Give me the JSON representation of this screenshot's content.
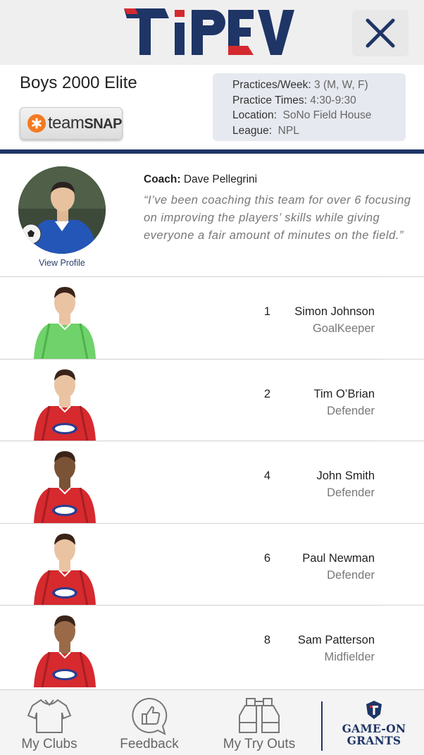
{
  "header": {
    "logo_text": "TiPEVO",
    "brand_colors": {
      "navy": "#1e3566",
      "red": "#d42a2f"
    }
  },
  "team": {
    "name": "Boys 2000 Elite",
    "teamsnap_label_part1": "team",
    "teamsnap_label_part2": "SNAP",
    "practice": {
      "per_week_label": "Practices/Week:",
      "per_week_value": "3 (M, W, F)",
      "times_label": "Practice Times:",
      "times_value": "4:30-9:30",
      "location_label": "Location:",
      "location_value": "SoNo Field House",
      "league_label": "League:",
      "league_value": "NPL"
    }
  },
  "coach": {
    "label": "Coach:",
    "name": "Dave Pellegrini",
    "quote": "“I’ve been coaching this team for over 6 focusing on improving the players’ skills while giving everyone a fair amount of minutes on the field.”",
    "view_profile": "View Profile"
  },
  "roster": [
    {
      "number": "1",
      "name": "Simon Johnson",
      "position": "GoalKeeper",
      "jersey": "green"
    },
    {
      "number": "2",
      "name": "Tim O’Brian",
      "position": "Defender",
      "jersey": "red"
    },
    {
      "number": "4",
      "name": "John Smith",
      "position": "Defender",
      "jersey": "red"
    },
    {
      "number": "6",
      "name": "Paul Newman",
      "position": "Defender",
      "jersey": "red"
    },
    {
      "number": "8",
      "name": "Sam Patterson",
      "position": "Midfielder",
      "jersey": "red"
    }
  ],
  "nav": {
    "my_clubs": "My Clubs",
    "feedback": "Feedback",
    "my_try_outs": "My Try Outs",
    "grants_line1": "GAME-ON",
    "grants_line2": "GRANTS"
  }
}
